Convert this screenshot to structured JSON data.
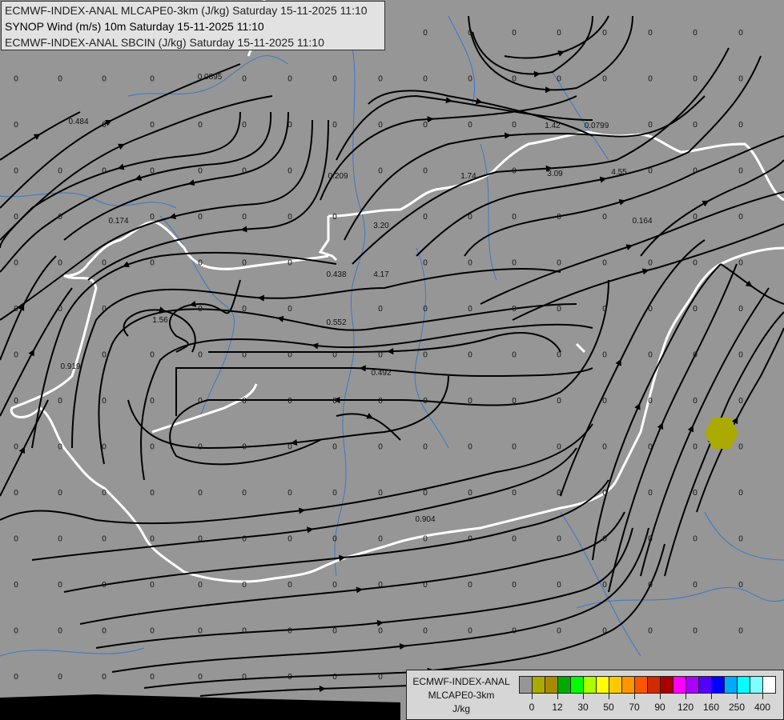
{
  "header": {
    "lines": [
      "ECMWF-INDEX-ANAL MLCAPE0-3km (J/kg) Saturday 15-11-2025 11:10",
      "SYNOP Wind (m/s) 10m Saturday 15-11-2025 11:10",
      "ECMWF-INDEX-ANAL SBCIN (J/kg) Saturday 15-11-2025 11:10"
    ]
  },
  "legend": {
    "model": "ECMWF-INDEX-ANAL",
    "parameter": "MLCAPE0-3km",
    "unit": "J/kg",
    "colors": [
      "#969696",
      "#aaaa00",
      "#aa8800",
      "#00aa00",
      "#00ff00",
      "#aaff00",
      "#ffff00",
      "#ffc800",
      "#ff9600",
      "#ff5500",
      "#d22a00",
      "#aa0000",
      "#ff00ff",
      "#aa00ff",
      "#5500ff",
      "#0000ff",
      "#00aaff",
      "#00ffff",
      "#80ffff",
      "#ffffff"
    ],
    "ticks": [
      "0",
      "12",
      "30",
      "50",
      "70",
      "90",
      "120",
      "160",
      "250",
      "400"
    ]
  },
  "map": {
    "cin_labels": [
      "0.0895",
      "0.484",
      "1.42",
      "0.0799",
      "0.209",
      "1.74",
      "3.09",
      "4.55",
      "3.20",
      "0.164",
      "0.174",
      "0.438",
      "4.17",
      "1.56",
      "0.552",
      "0.919",
      "0.492",
      "0.904"
    ],
    "zero_label": "0",
    "cape_marker_color": "#aaaa00"
  }
}
